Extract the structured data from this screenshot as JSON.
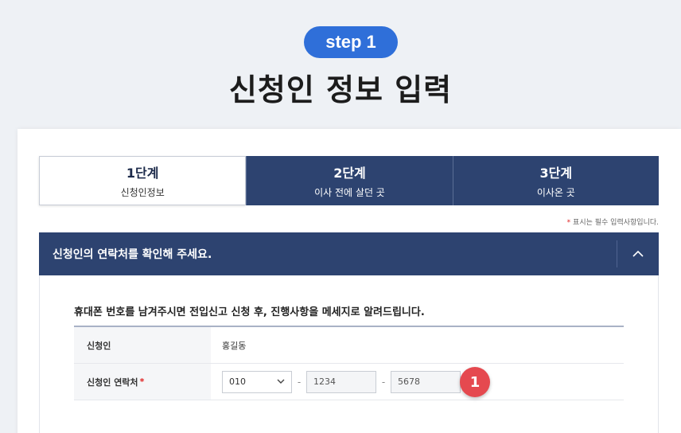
{
  "header": {
    "step_badge": "step 1",
    "title": "신청인 정보 입력"
  },
  "tabs": [
    {
      "label": "1단계",
      "sub": "신청인정보",
      "active": true
    },
    {
      "label": "2단계",
      "sub": "이사 전에 살던 곳",
      "active": false
    },
    {
      "label": "3단계",
      "sub": "이사온 곳",
      "active": false
    }
  ],
  "required_note": {
    "star": "*",
    "text": "표시는 필수 입력사항입니다."
  },
  "section": {
    "title": "신청인의 연락처를 확인해 주세요.",
    "toggle_icon": "chevron-up-icon",
    "guide": "휴대폰 번호를 남겨주시면 전입신고 신청 후, 진행사항을 메세지로 알려드립니다.",
    "rows": {
      "applicant_label": "신청인",
      "applicant_value": "홍길동",
      "contact_label": "신청인 연락처",
      "required_star": "*"
    },
    "phone": {
      "prefix": "010",
      "dash": "-",
      "middle": "1234",
      "last": "5678"
    }
  },
  "marker": {
    "number": "1"
  },
  "colors": {
    "brand_navy": "#2d4370",
    "step_blue": "#2f6fd9",
    "marker_red": "#e5494f",
    "required_red": "#e02424"
  }
}
